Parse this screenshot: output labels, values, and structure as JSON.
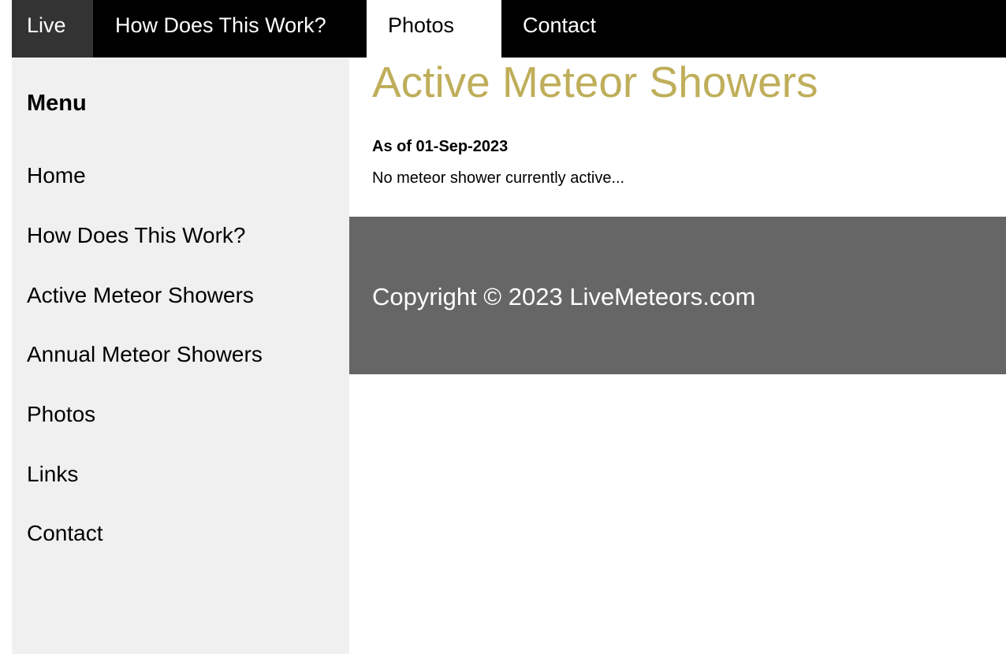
{
  "topnav": {
    "items": [
      {
        "label": "Live"
      },
      {
        "label": "How Does This Work?"
      },
      {
        "label": "Photos"
      },
      {
        "label": "Contact"
      }
    ],
    "active": "Photos"
  },
  "sidebar": {
    "heading": "Menu",
    "items": [
      {
        "label": "Home"
      },
      {
        "label": "How Does This Work?"
      },
      {
        "label": "Active Meteor Showers"
      },
      {
        "label": "Annual Meteor Showers"
      },
      {
        "label": "Photos"
      },
      {
        "label": "Links"
      },
      {
        "label": "Contact"
      }
    ]
  },
  "main": {
    "title": "Active Meteor Showers",
    "as_of": "As of 01-Sep-2023",
    "status": "No meteor shower currently active..."
  },
  "footer": {
    "copyright": "Copyright © 2023 LiveMeteors.com"
  },
  "colors": {
    "title_accent": "#bfae5a",
    "nav_bg": "#000000",
    "nav_live_bg": "#333333",
    "sidebar_bg": "#f0f0f0",
    "footer_bg": "#666666"
  }
}
